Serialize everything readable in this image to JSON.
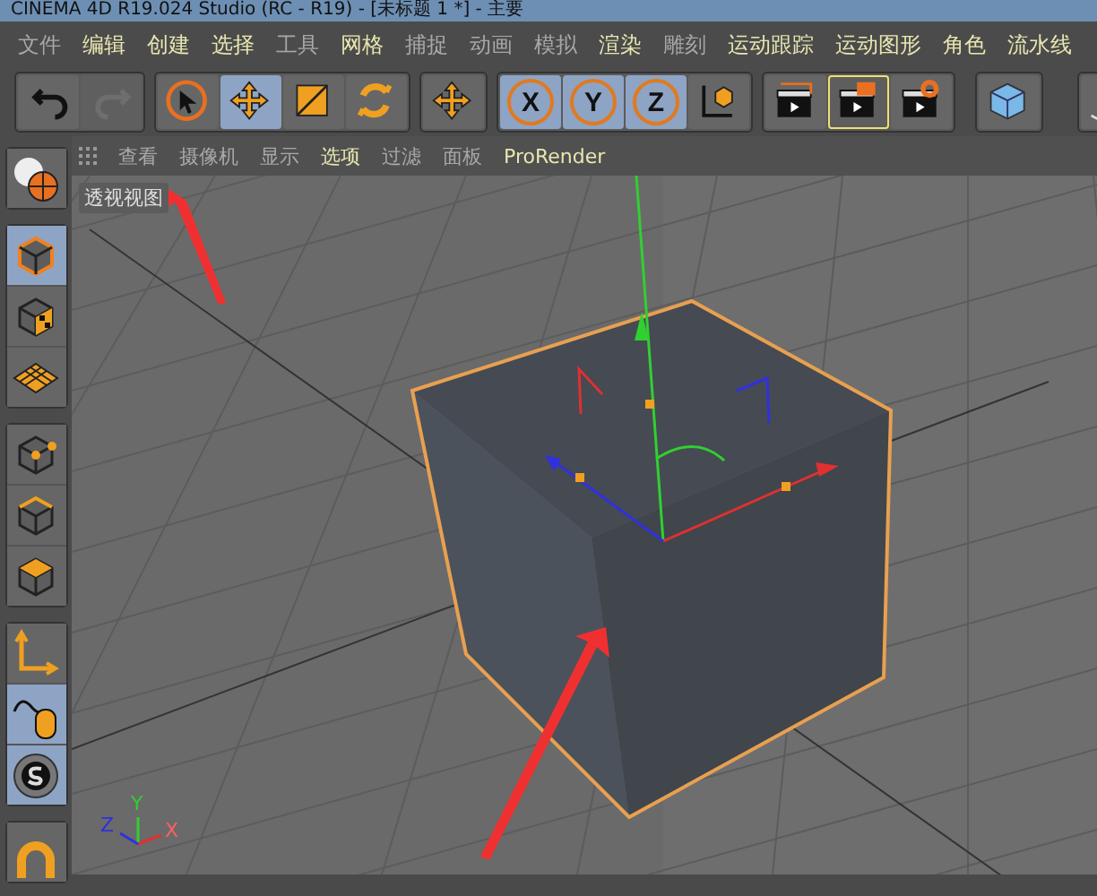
{
  "window": {
    "title": "CINEMA 4D R19.024 Studio (RC - R19) - [未标题 1 *] - 主要"
  },
  "menu": [
    {
      "label": "文件",
      "highlighted": false
    },
    {
      "label": "编辑",
      "highlighted": true
    },
    {
      "label": "创建",
      "highlighted": true
    },
    {
      "label": "选择",
      "highlighted": true
    },
    {
      "label": "工具",
      "highlighted": false
    },
    {
      "label": "网格",
      "highlighted": true
    },
    {
      "label": "捕捉",
      "highlighted": false
    },
    {
      "label": "动画",
      "highlighted": false
    },
    {
      "label": "模拟",
      "highlighted": false
    },
    {
      "label": "渲染",
      "highlighted": true
    },
    {
      "label": "雕刻",
      "highlighted": false
    },
    {
      "label": "运动跟踪",
      "highlighted": true
    },
    {
      "label": "运动图形",
      "highlighted": true
    },
    {
      "label": "角色",
      "highlighted": true
    },
    {
      "label": "流水线",
      "highlighted": true
    }
  ],
  "toolbar": [
    [
      {
        "kind": "undo",
        "selected": false,
        "disabled": false
      },
      {
        "kind": "redo",
        "selected": false,
        "disabled": true
      }
    ],
    [
      {
        "kind": "select",
        "selected": false,
        "disabled": false
      },
      {
        "kind": "move",
        "selected": true,
        "disabled": false
      },
      {
        "kind": "scale",
        "selected": false,
        "disabled": false
      },
      {
        "kind": "rotate",
        "selected": false,
        "disabled": false
      }
    ],
    [
      {
        "kind": "move",
        "selected": false,
        "disabled": false
      }
    ],
    [
      {
        "kind": "axis",
        "label": "X",
        "selected": true,
        "disabled": false
      },
      {
        "kind": "axis",
        "label": "Y",
        "selected": true,
        "disabled": false
      },
      {
        "kind": "axis",
        "label": "Z",
        "selected": true,
        "disabled": false
      },
      {
        "kind": "coords",
        "selected": false,
        "disabled": false
      }
    ],
    [
      {
        "kind": "render-view",
        "selected": false,
        "disabled": false
      },
      {
        "kind": "render-active",
        "selected": true,
        "disabled": false
      },
      {
        "kind": "render-settings",
        "selected": false,
        "disabled": false
      }
    ],
    [
      {
        "kind": "cube",
        "selected": false,
        "disabled": false
      }
    ],
    [
      {
        "kind": "pen",
        "selected": false,
        "disabled": false
      }
    ]
  ],
  "sidebar": [
    [
      {
        "kind": "globe",
        "selected": false
      }
    ],
    [
      {
        "kind": "model",
        "selected": true
      },
      {
        "kind": "texture",
        "selected": false
      },
      {
        "kind": "workplane",
        "selected": false
      }
    ],
    [
      {
        "kind": "points",
        "selected": false
      },
      {
        "kind": "edges",
        "selected": false
      },
      {
        "kind": "polygons",
        "selected": false
      }
    ],
    [
      {
        "kind": "axis-mode",
        "selected": false
      },
      {
        "kind": "tweak",
        "selected": true
      },
      {
        "kind": "snap",
        "selected": true
      }
    ],
    [
      {
        "kind": "magnet",
        "selected": false
      }
    ]
  ],
  "viewport": {
    "menu": [
      {
        "label": "查看",
        "highlighted": false
      },
      {
        "label": "摄像机",
        "highlighted": false
      },
      {
        "label": "显示",
        "highlighted": false
      },
      {
        "label": "选项",
        "highlighted": true
      },
      {
        "label": "过滤",
        "highlighted": false
      },
      {
        "label": "面板",
        "highlighted": false
      },
      {
        "label": "ProRender",
        "highlighted": true
      }
    ],
    "camera_label": "透视视图",
    "axis_labels": [
      "X",
      "Y",
      "Z"
    ]
  }
}
